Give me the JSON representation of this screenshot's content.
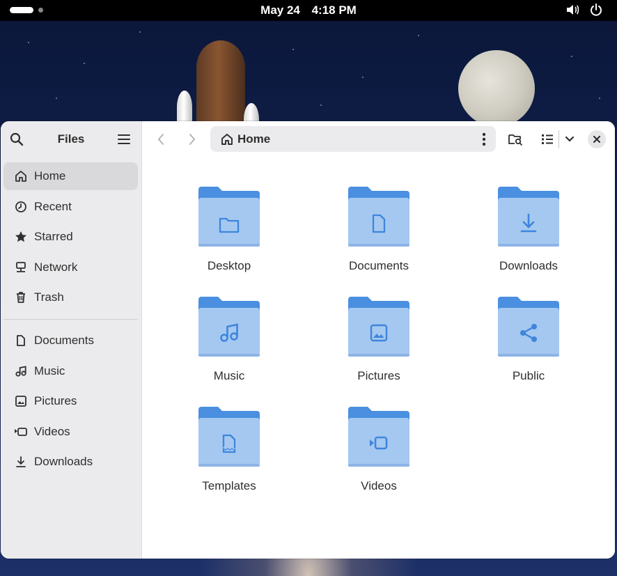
{
  "topbar": {
    "date": "May 24",
    "time": "4:18 PM"
  },
  "window": {
    "sidebar": {
      "title": "Files",
      "places": [
        {
          "label": "Home",
          "icon": "home-icon",
          "active": true
        },
        {
          "label": "Recent",
          "icon": "clock-icon",
          "active": false
        },
        {
          "label": "Starred",
          "icon": "star-icon",
          "active": false
        },
        {
          "label": "Network",
          "icon": "network-icon",
          "active": false
        },
        {
          "label": "Trash",
          "icon": "trash-icon",
          "active": false
        }
      ],
      "bookmarks": [
        {
          "label": "Documents",
          "icon": "document-icon"
        },
        {
          "label": "Music",
          "icon": "music-icon"
        },
        {
          "label": "Pictures",
          "icon": "picture-icon"
        },
        {
          "label": "Videos",
          "icon": "video-icon"
        },
        {
          "label": "Downloads",
          "icon": "download-icon"
        }
      ]
    },
    "pathbar": {
      "location": "Home"
    },
    "folders": [
      {
        "label": "Desktop",
        "emblem": "folder-emblem"
      },
      {
        "label": "Documents",
        "emblem": "document-emblem"
      },
      {
        "label": "Downloads",
        "emblem": "download-emblem"
      },
      {
        "label": "Music",
        "emblem": "music-emblem"
      },
      {
        "label": "Pictures",
        "emblem": "picture-emblem"
      },
      {
        "label": "Public",
        "emblem": "share-emblem"
      },
      {
        "label": "Templates",
        "emblem": "template-emblem"
      },
      {
        "label": "Videos",
        "emblem": "video-emblem"
      }
    ]
  },
  "colors": {
    "folder_back": "#4a8fe0",
    "folder_front": "#a4c8f0",
    "emblem": "#3f85dc",
    "sidebar_bg": "#ebebed",
    "sidebar_active": "#d9d9db",
    "text": "#2e2e2e"
  }
}
